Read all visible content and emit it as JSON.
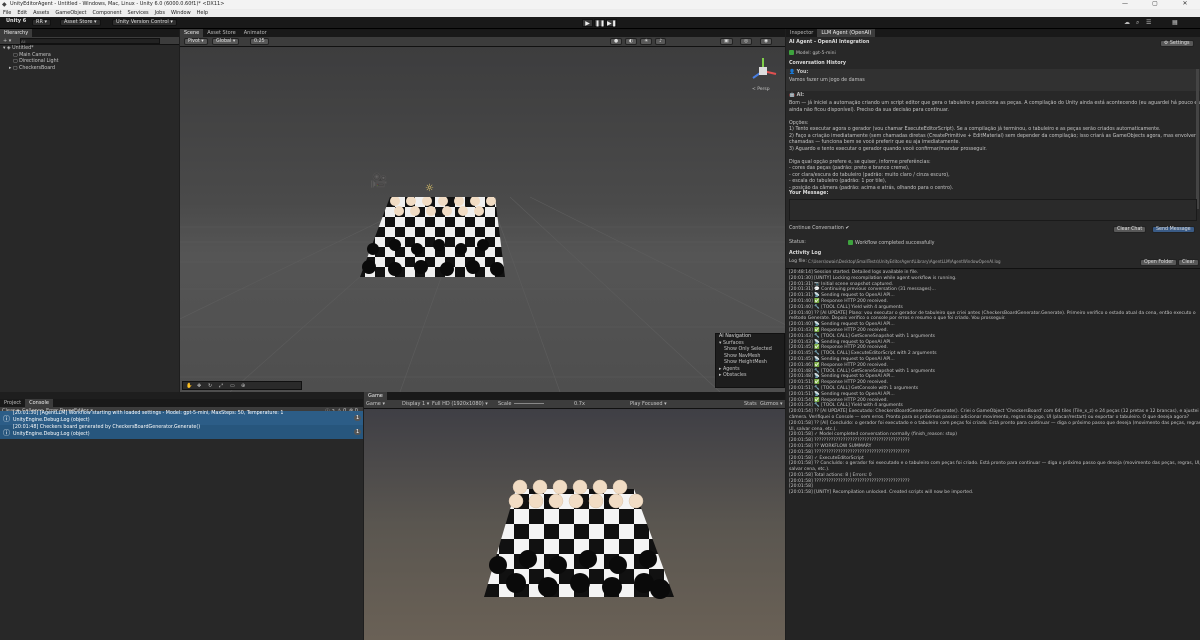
{
  "window": {
    "title": "UnityEditorAgent - Untitled - Windows, Mac, Linux - Unity 6.0 (6000.0.60f1)* <DX11>",
    "minimize": "—",
    "maximize": "▢",
    "close": "✕"
  },
  "menu": [
    "File",
    "Edit",
    "Assets",
    "GameObject",
    "Component",
    "Services",
    "Jobs",
    "Window",
    "Help"
  ],
  "toolbar": {
    "account": "Unity 6",
    "rr": "RR ▾",
    "asset_store": "Asset Store ▾",
    "version_control": "Unity Version Control ▾",
    "play": "▶",
    "pause": "❚❚",
    "step": "▶❚"
  },
  "hierarchy": {
    "tab": "Hierarchy",
    "add": "+ ▾",
    "search_placeholder": "All",
    "scene": "Untitled*",
    "items": [
      "Main Camera",
      "Directional Light",
      "CheckersBoard"
    ]
  },
  "scene_view": {
    "tabs": [
      "Scene",
      "Asset Store",
      "Animator"
    ],
    "pivot": "Pivot ▾",
    "global": "Global ▾",
    "grid_value": "0.25",
    "persp": "< Persp"
  },
  "nav_overlay": {
    "title": "AI Navigation",
    "surfaces": "Surfaces",
    "options": [
      "Show Only Selected",
      "Show NavMesh",
      "Show HeightMesh"
    ],
    "agents": "Agents",
    "obstacles": "Obstacles"
  },
  "console": {
    "tabs": [
      "Project",
      "Console"
    ],
    "buttons": [
      "Clear ▾",
      "Collapse",
      "Error Pause",
      "Editor ▾"
    ],
    "counts": {
      "info": "2",
      "warn": "0",
      "error": "0"
    },
    "logs": [
      {
        "line1": "[20:01:30] [AgentLLM] Workflow starting with loaded settings - Model: gpt-5-mini, MaxSteps: 50, Temperature: 1",
        "line2": "UnityEngine.Debug:Log (object)",
        "count": "1"
      },
      {
        "line1": "[20:01:48] Checkers board generated by CheckersBoardGenerator.Generate()",
        "line2": "UnityEngine.Debug:Log (object)",
        "count": "1"
      }
    ]
  },
  "game_view": {
    "tab": "Game",
    "display_mode": "Game ▾",
    "display": "Display 1 ▾",
    "resolution": "Full HD (1920x1080) ▾",
    "scale_label": "Scale",
    "scale_value": "0.7x",
    "play_focused": "Play Focused ▾",
    "stats": "Stats",
    "gizmos": "Gizmos ▾"
  },
  "agent_panel": {
    "tabs": [
      "Inspector",
      "LLM Agent (OpenAI)"
    ],
    "header": "AI Agent - OpenAI Integration",
    "model": "Model: gpt-5-mini",
    "settings": "Settings",
    "history_title": "Conversation History",
    "you_label": "You:",
    "you_text": "Vamos fazer um jogo de damas",
    "ai_label": "AI:",
    "ai_lines": [
      "Bom — já iniciei a automação criando um script editor que gera o tabuleiro e posiciona as peças. A compilação do Unity ainda está acontecendo (eu aguardei há pouco e a classe",
      "ainda não ficou disponível). Preciso da sua decisão para continuar.",
      "",
      "Opções:",
      "1) Tento executar agora o gerador (vou chamar ExecuteEditorScript). Se a compilação já terminou, o tabuleiro e as peças serão criados automaticamente.",
      "2) Faço a criação imediatamente (sem chamadas diretas (CreatePrimitive + EditMaterial) sem depender da compilação; isso criará as GameObjects agora, mas envolverá várias",
      "chamadas — funciona bem se você preferir que eu aja imediatamente.",
      "3) Aguardo e tento executar o gerador quando você confirmar/mandar prosseguir.",
      "",
      "Diga qual opção prefere e, se quiser, informe preferências:",
      "- cores das peças (padrão: preto e branco creme),",
      "- cor clara/escura do tabuleiro (padrão: muito claro / cinza escuro),",
      "- escala do tabuleiro (padrão: 1 por tile),",
      "- posição da câmera (padrão: acima e atrás, olhando para o centro)."
    ],
    "your_message_label": "Your Message:",
    "continue_label": "Continue Conversation",
    "clear_chat": "Clear Chat",
    "send_message": "Send Message",
    "status_label": "Status:",
    "status_text": "Workflow completed successfully",
    "activity_title": "Activity Log",
    "log_file_label": "Log file:",
    "log_file": "C:\\Users\\owais\\Desktop\\SmallTests\\UnityEditorAgent\\Library\\AgentLLM\\AgentWindowOpenAI.log",
    "open_folder": "Open Folder",
    "clear": "Clear",
    "activity": [
      "[20:48:14] Session started. Detailed logs available in file.",
      "[20:01:30] [UNITY] Locking recompilation while agent workflow is running.",
      "[20:01:31] 📷 Initial scene snapshot captured.",
      "[20:01:31] 💬 Continuing previous conversation (31 messages)...",
      "[20:01:31] 📡 Sending request to OpenAI API...",
      "[20:01:40] ✅ Response HTTP 200 received.",
      "[20:01:40] 🔧 [TOOL CALL] Yield with 4 arguments",
      "[20:01:40] ?? [AI UPDATE] Plano: vou executar o gerador de tabuleiro que criei antes (CheckersBoardGenerator.Generate). Primeiro verifico o estado atual da cena, então executo o",
      "método Generate. Depois verifico o console por erros e resumo o que foi criado. Vou prosseguir.",
      "[20:01:40] 📡 Sending request to OpenAI API...",
      "[20:01:43] ✅ Response HTTP 200 received.",
      "[20:01:43] 🔧 [TOOL CALL] GetSceneSnapshot with 1 arguments",
      "[20:01:43] 📡 Sending request to OpenAI API...",
      "[20:01:45] ✅ Response HTTP 200 received.",
      "[20:01:45] 🔧 [TOOL CALL] ExecuteEditorScript with 2 arguments",
      "[20:01:45] 📡 Sending request to OpenAI API...",
      "[20:01:46] ✅ Response HTTP 200 received.",
      "[20:01:48] 🔧 [TOOL CALL] GetSceneSnapshot with 1 arguments",
      "[20:01:48] 📡 Sending request to OpenAI API...",
      "[20:01:51] ✅ Response HTTP 200 received.",
      "[20:01:51] 🔧 [TOOL CALL] GetConsole with 1 arguments",
      "[20:01:51] 📡 Sending request to OpenAI API...",
      "[20:01:54] ✅ Response HTTP 200 received.",
      "[20:01:54] 🔧 [TOOL CALL] Yield with 4 arguments",
      "[20:01:54] ?? [AI UPDATE] Executado: CheckersBoardGenerator.Generate(). Criei o GameObject 'CheckersBoard' com 64 tiles (Tile_x_z) e 24 peças (12 pretas e 12 brancas), e ajustei a",
      "câmera. Verifiquei o Console — sem erros. Pronto para os próximos passos: adicionar movimento, regras do jogo, UI (placar/restart) ou exportar o tabuleiro. O que deseja agora?",
      "[20:01:58] ?? [AI] Concluído: o gerador foi executado e o tabuleiro com peças foi criado. Está pronto para continuar — diga o próximo passo que deseja (movimento das peças, regras,",
      "UI, salvar cena, etc.).",
      "[20:01:58] ✓ Model completed conversation normally (finish_reason: stop)",
      "[20:01:58] ????????????????????????????????????????",
      "[20:01:58] ?? WORKFLOW SUMMARY",
      "[20:01:58] ????????????????????????????????????????",
      "[20:01:58] ✓ ExecuteEditorScript",
      "[20:01:58] ?? Concluído: o gerador foi executado e o tabuleiro com peças foi criado. Está pronto para continuar — diga o próximo passo que deseja (movimento das peças, regras, UI,",
      "salvar cena, etc.).",
      "[20:01:58] Total actions: 8 | Errors: 0",
      "[20:01:58] ????????????????????????????????????????",
      "[20:01:58]",
      "[20:01:58] [UNITY] Recompilation unlocked. Created scripts will now be imported."
    ]
  }
}
